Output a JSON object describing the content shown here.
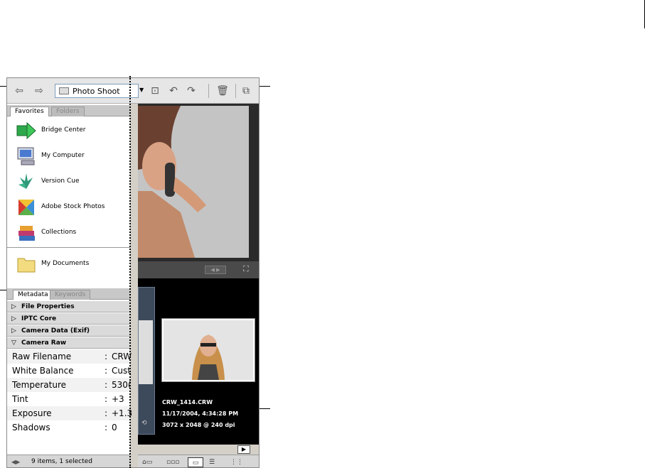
{
  "toolbar": {
    "back_icon": "back-arrow-icon",
    "forward_icon": "forward-arrow-icon",
    "location": "Photo Shoot",
    "icons": [
      "new-folder-icon",
      "rotate-left-icon",
      "rotate-right-icon",
      "trash-icon",
      "compact-mode-icon"
    ]
  },
  "top_tabs": {
    "favorites": "Favorites",
    "folders": "Folders"
  },
  "favorites": [
    {
      "label": "Bridge Center",
      "icon": "bridge-center-icon"
    },
    {
      "label": "My Computer",
      "icon": "computer-icon"
    },
    {
      "label": "Version Cue",
      "icon": "version-cue-icon"
    },
    {
      "label": "Adobe Stock Photos",
      "icon": "stock-photos-icon"
    },
    {
      "label": "Collections",
      "icon": "collections-icon"
    },
    {
      "label": "My Documents",
      "icon": "folder-icon"
    }
  ],
  "bottom_tabs": {
    "metadata": "Metadata",
    "keywords": "Keywords"
  },
  "metadata_sections": [
    {
      "label": "File Properties",
      "expanded": false
    },
    {
      "label": "IPTC Core",
      "expanded": false
    },
    {
      "label": "Camera Data (Exif)",
      "expanded": false
    },
    {
      "label": "Camera Raw",
      "expanded": true
    }
  ],
  "camera_raw_fields": [
    {
      "key": "Raw Filename",
      "value": "CRW"
    },
    {
      "key": "White Balance",
      "value": "Cust"
    },
    {
      "key": "Temperature",
      "value": "530("
    },
    {
      "key": "Tint",
      "value": "+3"
    },
    {
      "key": "Exposure",
      "value": "+1.3"
    },
    {
      "key": "Shadows",
      "value": "0"
    }
  ],
  "status": {
    "text": "9 items, 1 selected"
  },
  "thumbnail_info": {
    "filename": "CRW_1414.CRW",
    "date": "11/17/2004, 4:34:28 PM",
    "dimensions": "3072 x 2048 @ 240 dpi"
  },
  "colors": {
    "panel_bg": "#d4d0c8",
    "content_bg": "#000000",
    "header_bg": "#dadada"
  }
}
